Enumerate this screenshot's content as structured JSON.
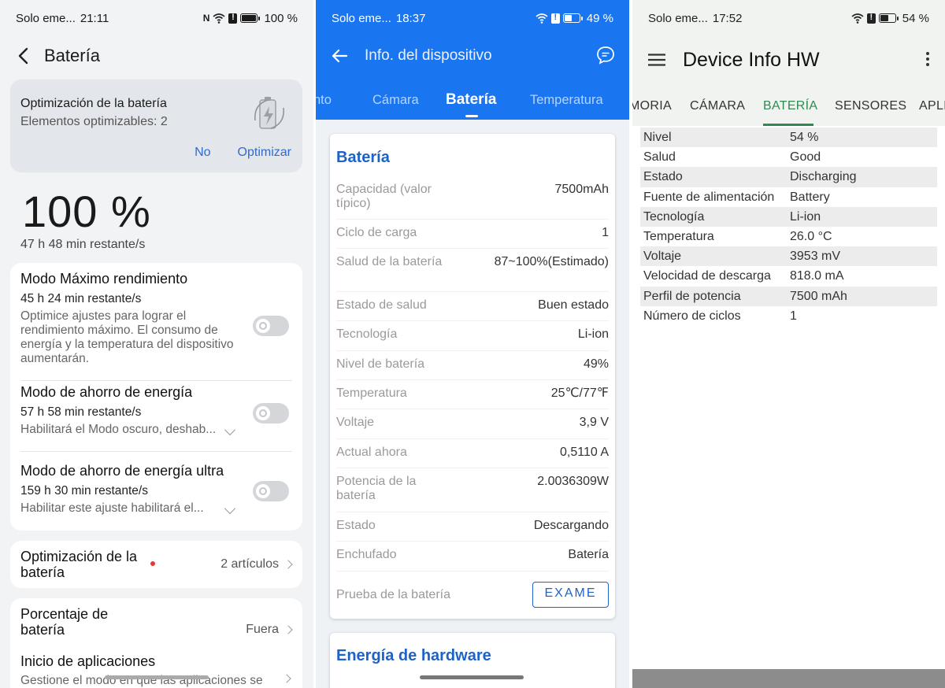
{
  "panel1": {
    "status": {
      "carrier": "Solo eme...",
      "time": "21:11",
      "battery": "100 %",
      "battery_fill": 1.0
    },
    "header": {
      "title": "Batería"
    },
    "optimization_card": {
      "title": "Optimización de la batería",
      "subtitle": "Elementos optimizables: 2",
      "no_label": "No",
      "optimize_label": "Optimizar",
      "icon": "battery-bolt-icon"
    },
    "level": "100 %",
    "remaining": "47 h 48 min restante/s",
    "modes": [
      {
        "title": "Modo Máximo rendimiento",
        "remaining": "45 h 24 min restante/s",
        "desc": "Optimice ajustes para lograr el rendimiento máximo. El consumo de energía y la temperatura del dispositivo aumentarán.",
        "enabled": false
      },
      {
        "title": "Modo de ahorro de energía",
        "remaining": "57 h 58 min restante/s",
        "desc": "Habilitará el Modo oscuro, deshab...",
        "enabled": false
      },
      {
        "title": "Modo de ahorro de energía ultra",
        "remaining": "159 h 30 min restante/s",
        "desc": "Habilitar este ajuste habilitará el...",
        "enabled": false
      }
    ],
    "battery_opt_row": {
      "title": "Optimización de la batería",
      "value": "2 artículos"
    },
    "percent_row": {
      "title": "Porcentaje de batería",
      "value": "Fuera"
    },
    "app_launch_row": {
      "title": "Inicio de aplicaciones",
      "desc": "Gestione el modo en que las aplicaciones se"
    }
  },
  "panel2": {
    "status": {
      "carrier": "Solo eme...",
      "time": "18:37",
      "battery": "49 %",
      "battery_fill": 0.49
    },
    "header": {
      "title": "Info. del dispositivo"
    },
    "tabs": [
      "nto",
      "Cámara",
      "Batería",
      "Temperatura"
    ],
    "active_tab": "Batería",
    "section_title": "Batería",
    "rows": [
      {
        "label": "Capacidad (valor típico)",
        "value": "7500mAh"
      },
      {
        "label": "Ciclo de carga",
        "value": "1"
      },
      {
        "label": "Salud de la batería",
        "value": "87~100%(Estimado)"
      },
      {
        "label": "Estado de salud",
        "value": "Buen estado"
      },
      {
        "label": "Tecnología",
        "value": "Li-ion"
      },
      {
        "label": "Nivel de batería",
        "value": "49%"
      },
      {
        "label": "Temperatura",
        "value": "25℃/77℉"
      },
      {
        "label": "Voltaje",
        "value": "3,9 V"
      },
      {
        "label": "Actual ahora",
        "value": "0,5110 A"
      },
      {
        "label": "Potencia de la batería",
        "value": "2.0036309W"
      },
      {
        "label": "Estado",
        "value": "Descargando"
      },
      {
        "label": "Enchufado",
        "value": "Batería"
      }
    ],
    "test_label": "Prueba de la batería",
    "exam_button": "EXAME",
    "next_section": "Energía de hardware"
  },
  "panel3": {
    "status": {
      "carrier": "Solo eme...",
      "time": "17:52",
      "battery": "54 %",
      "battery_fill": 0.54
    },
    "header": {
      "title": "Device Info HW"
    },
    "tabs": [
      "MORIA",
      "CÁMARA",
      "BATERÍA",
      "SENSORES",
      "APLI"
    ],
    "active_tab": "BATERÍA",
    "rows": [
      {
        "label": "Nivel",
        "value": "54 %"
      },
      {
        "label": "Salud",
        "value": "Good"
      },
      {
        "label": "Estado",
        "value": "Discharging"
      },
      {
        "label": "Fuente de alimentación",
        "value": "Battery"
      },
      {
        "label": "Tecnología",
        "value": "Li-ion"
      },
      {
        "label": "Temperatura",
        "value": "26.0 °C"
      },
      {
        "label": "Voltaje",
        "value": "3953 mV"
      },
      {
        "label": "Velocidad de descarga",
        "value": "818.0 mA"
      },
      {
        "label": "Perfil de potencia",
        "value": "7500 mAh"
      },
      {
        "label": "Número de ciclos",
        "value": "1"
      }
    ]
  },
  "colors": {
    "panel2_accent": "#1976f0",
    "panel2_heading": "#1e62c8",
    "panel3_accent": "#2f8a52",
    "panel1_link": "#2f6bd1"
  }
}
